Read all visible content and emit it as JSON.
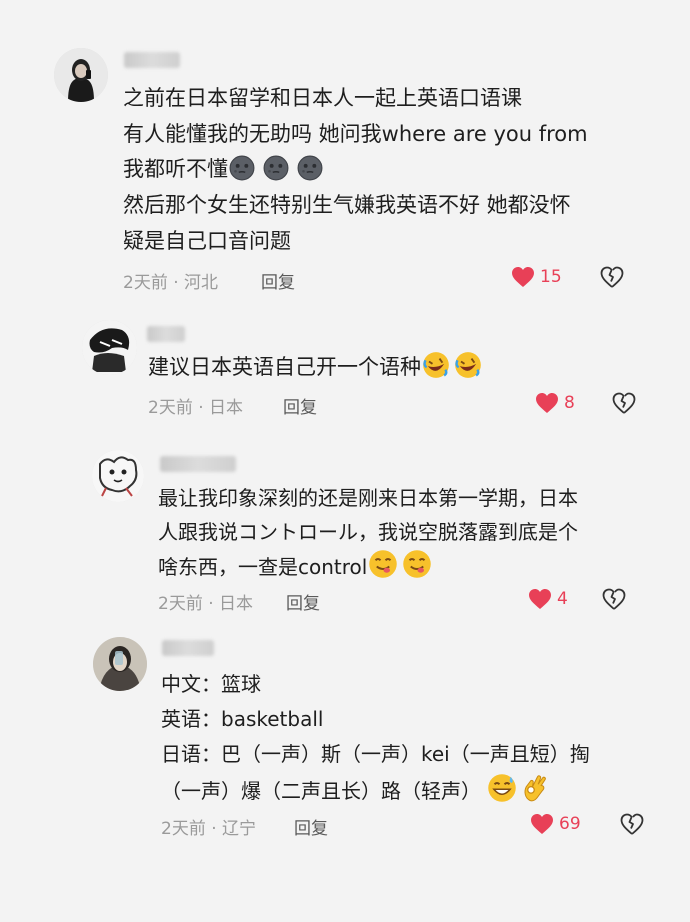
{
  "comments": [
    {
      "lines": [
        "之前在日本留学和日本人一起上英语口语课",
        "有人能懂我的无助吗 她问我where are you from",
        "我都听不懂",
        "然后那个女生还特别生气嫌我英语不好 她都没怀",
        "疑是自己口音问题"
      ],
      "meta": "2天前 · 河北",
      "reply": "回复",
      "likes": "15"
    },
    {
      "lines": [
        "建议日本英语自己开一个语种"
      ],
      "meta": "2天前 · 日本",
      "reply": "回复",
      "likes": "8"
    },
    {
      "lines": [
        "最让我印象深刻的还是刚来日本第一学期，日本",
        "人跟我说コントロール，我说空脱落露到底是个",
        "啥东西，一查是control"
      ],
      "meta": "2天前 · 日本",
      "reply": "回复",
      "likes": "4"
    },
    {
      "lines": [
        "中文：篮球",
        "英语：basketball",
        "日语：巴（一声）斯（一声）kei（一声且短）掏",
        "（一声）爆（二声且长）路（轻声）"
      ],
      "meta": "2天前 · 辽宁",
      "reply": "回复",
      "likes": "69"
    }
  ],
  "icons": {
    "like": "heart-icon",
    "dislike": "broken-heart-icon",
    "emoji_1": "dark-moon-face-emoji",
    "emoji_2": "rofl-emoji",
    "emoji_3": "savoring-face-emoji",
    "emoji_4": "grinning-sweat-emoji",
    "emoji_5": "ok-hand-emoji"
  },
  "colors": {
    "like": "#e84057",
    "meta": "#9a9a9a",
    "background": "#f3f3f3"
  }
}
